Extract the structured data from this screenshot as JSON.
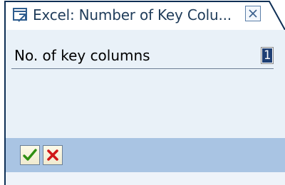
{
  "window": {
    "title": "Excel: Number of Key Colu",
    "title_ellipsis": "..."
  },
  "form": {
    "key_columns_label": "No. of key columns",
    "key_columns_value": "1"
  },
  "colors": {
    "frame": "#0e2f55",
    "title_text": "#1f3c5a",
    "body": "#e9f1f8",
    "toolbar": "#a9c4e3",
    "input_selection": "#1e3f74",
    "confirm": "#2f8f12",
    "cancel": "#d01818"
  },
  "icons": {
    "title": "window-icon",
    "close": "close-icon",
    "confirm": "checkmark-icon",
    "cancel": "cancel-x-icon"
  }
}
